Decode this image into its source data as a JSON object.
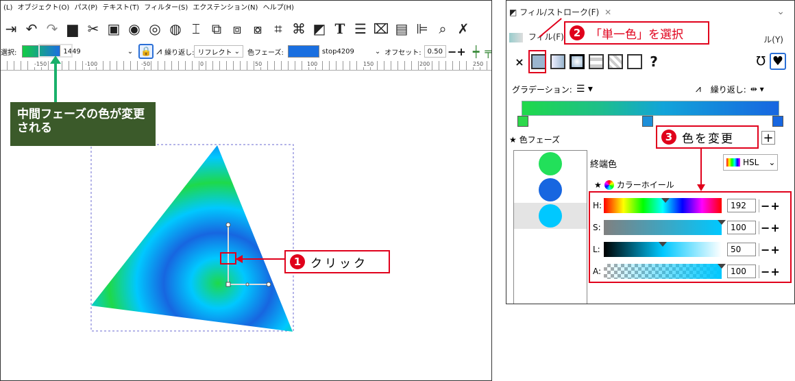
{
  "menu": {
    "items": [
      "(L)",
      "オブジェクト(O)",
      "パス(P)",
      "テキスト(T)",
      "フィルター(S)",
      "エクステンション(N)",
      "ヘルプ(H)"
    ]
  },
  "ctrlbar": {
    "select_label": "選択:",
    "gradient_id": "1449",
    "repeat_label": "繰り返し:",
    "repeat_value": "リフレクト",
    "stop_label": "色フェーズ:",
    "stop_id": "stop4209",
    "offset_label": "オフセット:",
    "offset_value": "0.50"
  },
  "ruler": {
    "labels": [
      "-150",
      "-100",
      "-50",
      "0",
      "50",
      "100",
      "150",
      "200",
      "250"
    ]
  },
  "annotations": {
    "note_text": "中間フェーズの色が変更される",
    "callout1": {
      "num": "1",
      "text": "クリック"
    },
    "callout2": {
      "num": "2",
      "text": "「単一色」を選択"
    },
    "callout3": {
      "num": "3",
      "text": "色を変更"
    }
  },
  "panel": {
    "title": "フィル/ストローク(F)",
    "tab_fill": "フィル(F)",
    "tab_stroke_style": "ル(Y)",
    "gradient_label": "グラデーション:",
    "repeat_label": "繰り返し:",
    "stops_title": "色フェーズ",
    "end_color_label": "終端色",
    "color_mode": "HSL",
    "wheel_label": "カラーホイール",
    "unset_symbol": "?",
    "x_symbol": "×",
    "stops": [
      {
        "color": "#22e05a"
      },
      {
        "color": "#1766e0"
      },
      {
        "color": "#00c8ff",
        "selected": true
      }
    ],
    "sliders": {
      "h": {
        "label": "H:",
        "value": "192"
      },
      "s": {
        "label": "S:",
        "value": "100"
      },
      "l": {
        "label": "L:",
        "value": "50"
      },
      "a": {
        "label": "A:",
        "value": "100"
      }
    },
    "pm": "−+"
  },
  "colors": {
    "accent_red": "#e0001b",
    "note_green": "#3b5a2a",
    "arrow_green": "#19b06a"
  }
}
